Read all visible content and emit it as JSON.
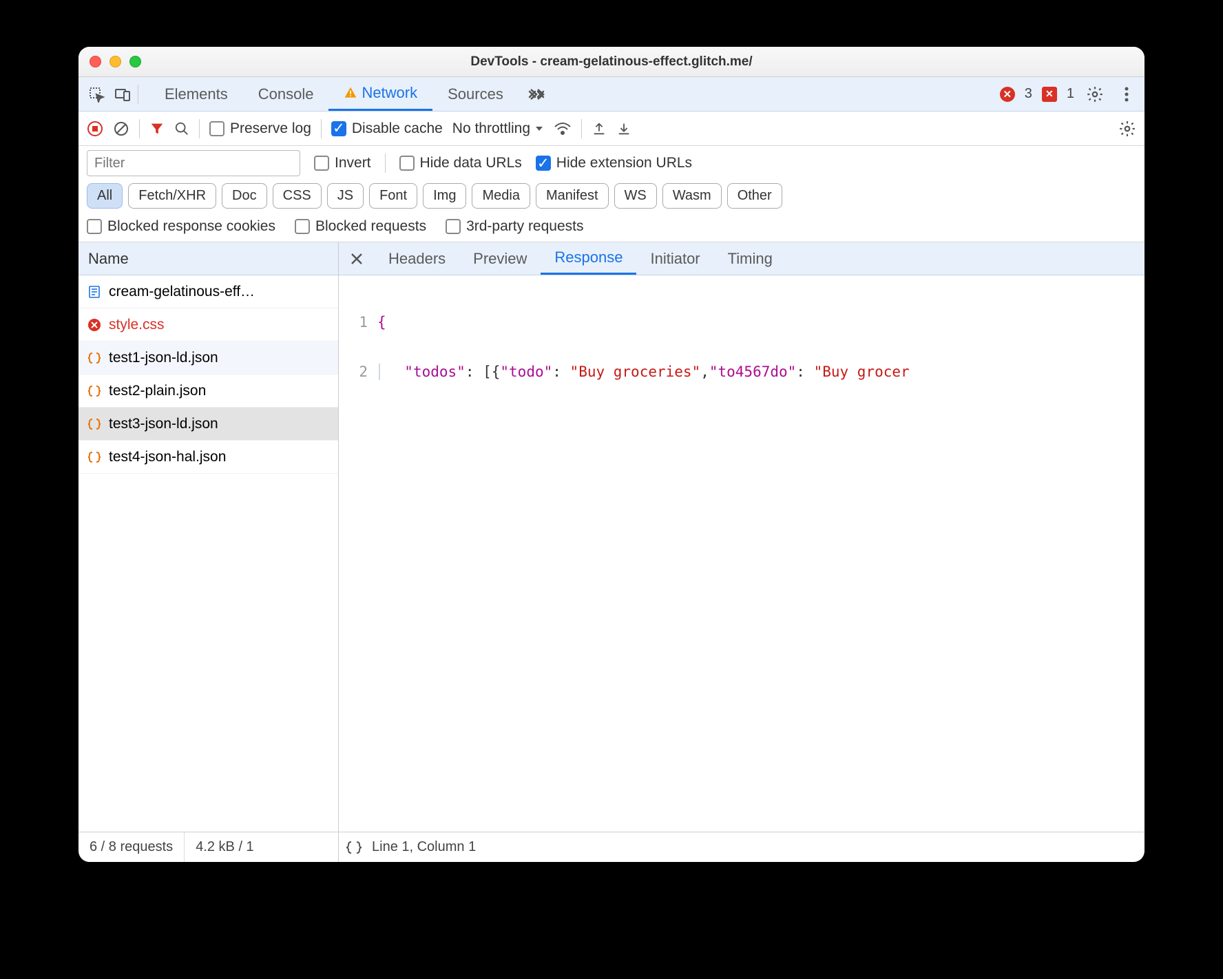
{
  "window": {
    "title": "DevTools - cream-gelatinous-effect.glitch.me/"
  },
  "tabs": {
    "elements": "Elements",
    "console": "Console",
    "network": "Network",
    "sources": "Sources"
  },
  "counts": {
    "errors": "3",
    "issues": "1"
  },
  "toolbar": {
    "preserve_log": "Preserve log",
    "disable_cache": "Disable cache",
    "throttling": "No throttling"
  },
  "filter": {
    "placeholder": "Filter",
    "invert": "Invert",
    "hide_data": "Hide data URLs",
    "hide_ext": "Hide extension URLs"
  },
  "types": [
    "All",
    "Fetch/XHR",
    "Doc",
    "CSS",
    "JS",
    "Font",
    "Img",
    "Media",
    "Manifest",
    "WS",
    "Wasm",
    "Other"
  ],
  "blocked": {
    "cookies": "Blocked response cookies",
    "requests": "Blocked requests",
    "third": "3rd-party requests"
  },
  "reqlist": {
    "header": "Name",
    "items": [
      {
        "label": "cream-gelatinous-eff…",
        "icon": "doc",
        "err": false
      },
      {
        "label": "style.css",
        "icon": "err",
        "err": true
      },
      {
        "label": "test1-json-ld.json",
        "icon": "json",
        "err": false
      },
      {
        "label": "test2-plain.json",
        "icon": "json",
        "err": false
      },
      {
        "label": "test3-json-ld.json",
        "icon": "json",
        "err": false
      },
      {
        "label": "test4-json-hal.json",
        "icon": "json",
        "err": false
      }
    ]
  },
  "detail_tabs": [
    "Headers",
    "Preview",
    "Response",
    "Initiator",
    "Timing"
  ],
  "response": {
    "lines": [
      {
        "n": "1",
        "raw": "{"
      },
      {
        "n": "2",
        "raw": "  \"todos\": [{\"todo\": \"Buy groceries\",\"to4567do\": \"Buy grocer"
      }
    ]
  },
  "status": {
    "requests": "6 / 8 requests",
    "size": "4.2 kB / 1",
    "cursor": "Line 1, Column 1"
  }
}
